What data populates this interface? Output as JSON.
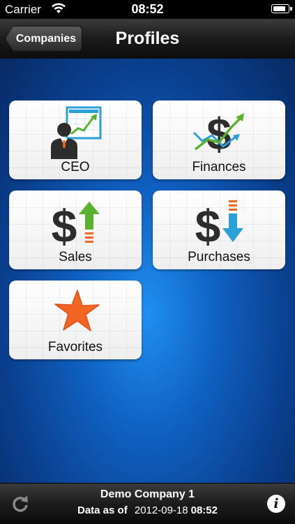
{
  "status_bar": {
    "carrier": "Carrier",
    "time": "08:52",
    "battery_level": 0.9
  },
  "nav": {
    "back_label": "Companies",
    "title": "Profiles"
  },
  "tiles": [
    {
      "label": "CEO",
      "icon": "ceo-icon"
    },
    {
      "label": "Finances",
      "icon": "finances-icon"
    },
    {
      "label": "Sales",
      "icon": "sales-icon"
    },
    {
      "label": "Purchases",
      "icon": "purchases-icon"
    },
    {
      "label": "Favorites",
      "icon": "star-icon"
    }
  ],
  "footer": {
    "company": "Demo Company 1",
    "data_as_of_label": "Data as of",
    "date": "2012-09-18",
    "time": "08:52",
    "refresh_icon": "refresh-icon",
    "info_icon": "info-icon"
  },
  "colors": {
    "accent_green": "#5ab02f",
    "accent_blue": "#2aa0d8",
    "accent_orange": "#f26522",
    "dollar_dark": "#2d2d2d"
  }
}
